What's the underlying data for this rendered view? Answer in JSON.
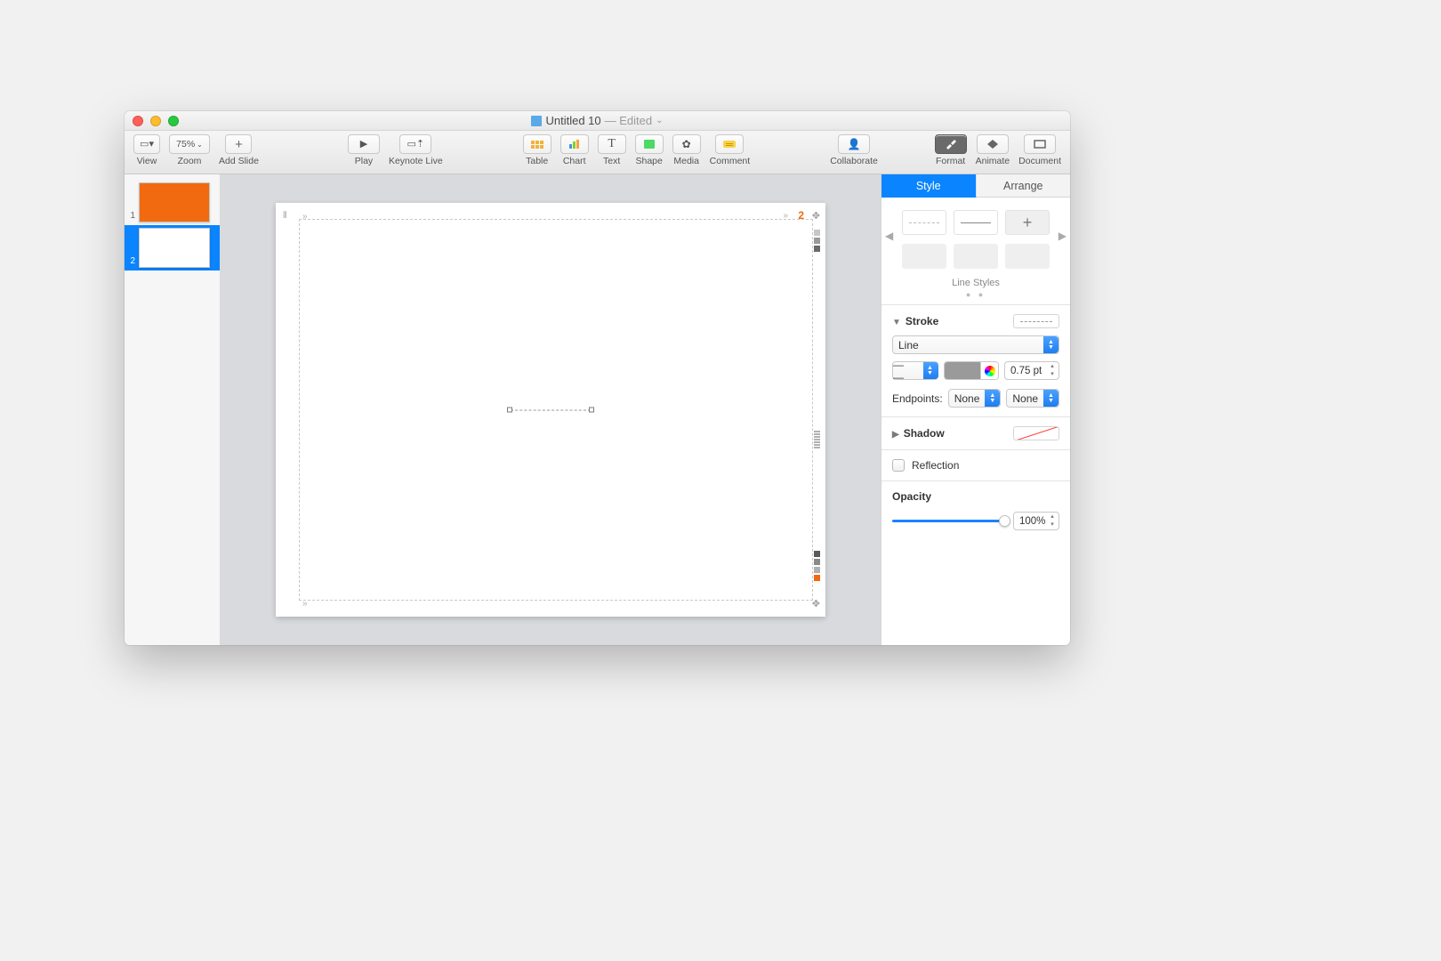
{
  "title": {
    "name": "Untitled 10",
    "status": "Edited"
  },
  "toolbar": {
    "view": "View",
    "zoom": "Zoom",
    "zoom_value": "75%",
    "add_slide": "Add Slide",
    "play": "Play",
    "keynote_live": "Keynote Live",
    "table": "Table",
    "chart": "Chart",
    "text": "Text",
    "shape": "Shape",
    "media": "Media",
    "comment": "Comment",
    "collaborate": "Collaborate",
    "format": "Format",
    "animate": "Animate",
    "document": "Document"
  },
  "navigator": {
    "slides": [
      {
        "num": "1"
      },
      {
        "num": "2"
      }
    ]
  },
  "canvas": {
    "current_slide": "2"
  },
  "inspector": {
    "tabs": {
      "style": "Style",
      "arrange": "Arrange"
    },
    "gallery_label": "Line Styles",
    "stroke": {
      "label": "Stroke",
      "type": "Line",
      "width": "0.75 pt"
    },
    "endpoints": {
      "label": "Endpoints:",
      "start": "None",
      "end": "None"
    },
    "shadow": {
      "label": "Shadow"
    },
    "reflection": {
      "label": "Reflection"
    },
    "opacity": {
      "label": "Opacity",
      "value": "100%"
    }
  }
}
